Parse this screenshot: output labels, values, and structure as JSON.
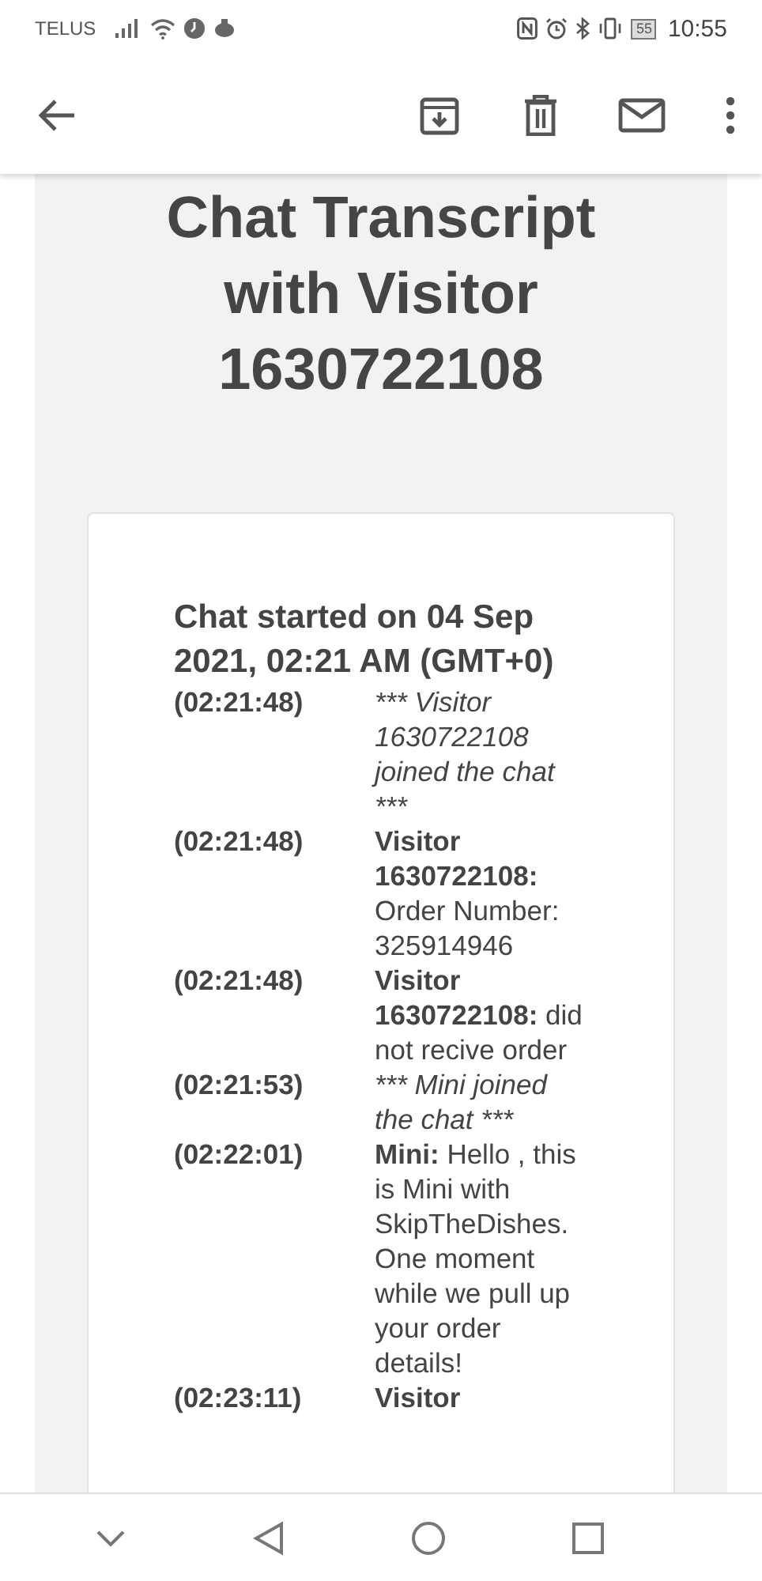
{
  "status_bar": {
    "carrier": "TELUS",
    "battery": "55",
    "time": "10:55"
  },
  "transcript": {
    "title": "Chat Transcript with Visitor 1630722108",
    "started": "Chat started on 04 Sep 2021, 02:21 AM (GMT+0)",
    "messages": [
      {
        "time": "(02:21:48)",
        "kind": "event",
        "text": "*** Visitor 1630722108 joined the chat ***"
      },
      {
        "time": "(02:21:48)",
        "kind": "message",
        "sender": "Visitor 1630722108:",
        "text": "Order Number: 325914946"
      },
      {
        "time": "(02:21:48)",
        "kind": "message",
        "sender": "Visitor 1630722108:",
        "text": "did not recive order"
      },
      {
        "time": "(02:21:53)",
        "kind": "event",
        "text": "*** Mini joined the chat ***"
      },
      {
        "time": "(02:22:01)",
        "kind": "message",
        "sender": "Mini:",
        "text": "Hello , this is Mini with SkipTheDishes. One moment while we pull up your order details!"
      },
      {
        "time": "(02:23:11)",
        "kind": "message",
        "sender": "Visitor"
      }
    ]
  }
}
